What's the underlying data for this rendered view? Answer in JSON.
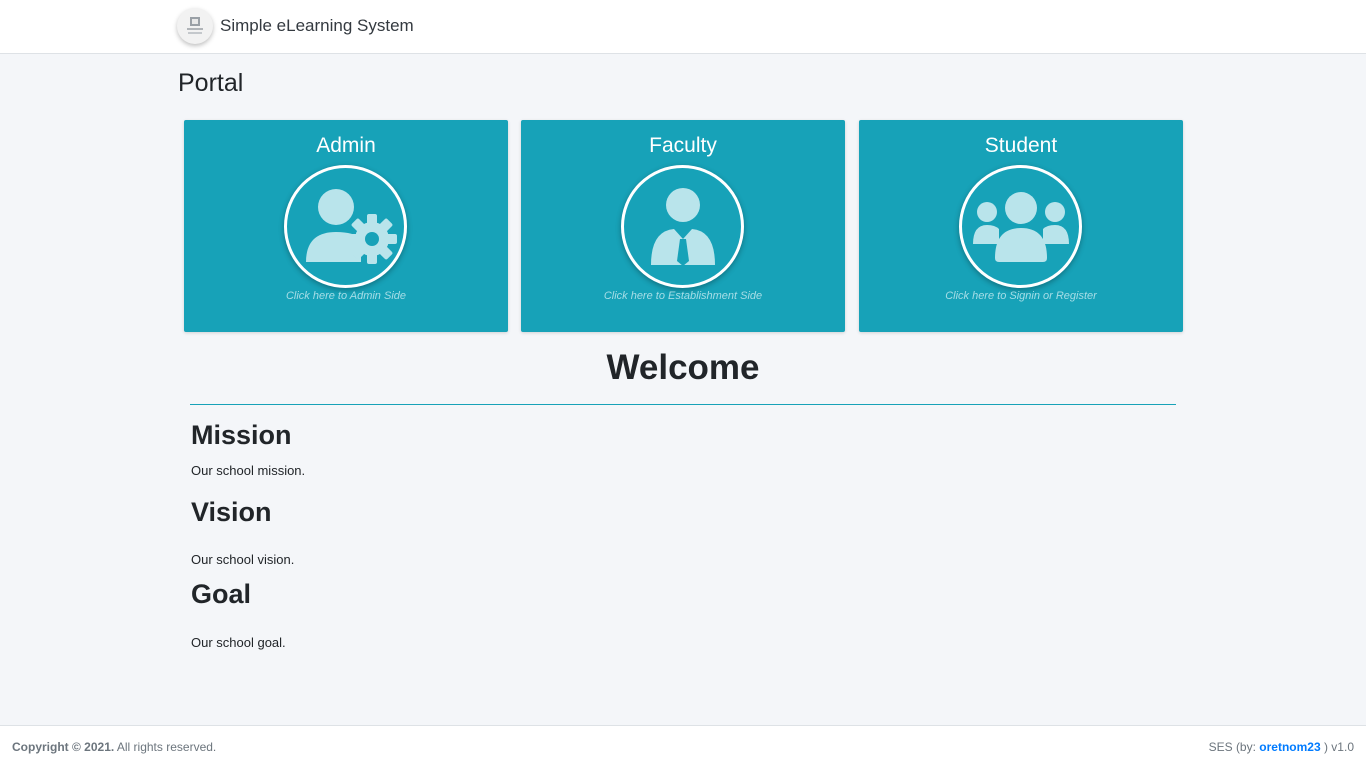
{
  "navbar": {
    "brand_text": "Simple eLearning System",
    "logo_icon": "school-logo-icon"
  },
  "page": {
    "title": "Portal"
  },
  "cards": [
    {
      "title": "Admin",
      "hint": "Click here to Admin Side",
      "icon": "user-gear-icon"
    },
    {
      "title": "Faculty",
      "hint": "Click here to Establishment Side",
      "icon": "user-tie-icon"
    },
    {
      "title": "Student",
      "hint": "Click here to Signin or Register",
      "icon": "users-icon"
    }
  ],
  "welcome": {
    "heading": "Welcome"
  },
  "sections": {
    "mission": {
      "heading": "Mission",
      "text": "Our school mission."
    },
    "vision": {
      "heading": "Vision",
      "text": "Our school vision."
    },
    "goal": {
      "heading": "Goal",
      "text": "Our school goal."
    }
  },
  "footer": {
    "copyright_bold": "Copyright © 2021.",
    "copyright_rest": " All rights reserved.",
    "right_prefix": "SES (by: ",
    "author_link": "oretnom23",
    "right_suffix": " ) v1.0"
  },
  "colors": {
    "accent": "#17a2b8",
    "icon_fill": "#b9e4eb",
    "background": "#f4f6f9",
    "link": "#007bff"
  }
}
